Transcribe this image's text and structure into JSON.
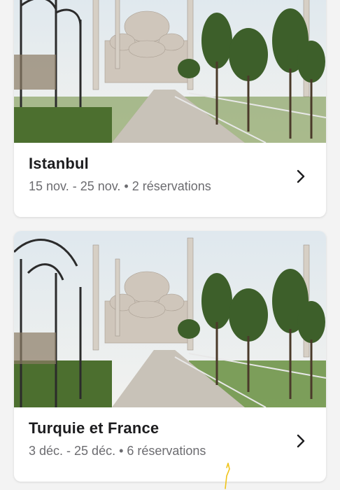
{
  "trips": [
    {
      "title": "Istanbul",
      "meta": "15 nov. - 25 nov. • 2 réservations",
      "image": "blue-mosque-photo"
    },
    {
      "title": "Turquie et France",
      "meta": "3 déc. - 25 déc. • 6 réservations",
      "image": "blue-mosque-photo"
    }
  ],
  "colors": {
    "background": "#f3f3f3",
    "card": "#ffffff",
    "title": "#1d1d1f",
    "meta": "#6c6c70",
    "chevron": "#1d1d1f"
  },
  "icons": {
    "chevron": "chevron-right-icon"
  }
}
